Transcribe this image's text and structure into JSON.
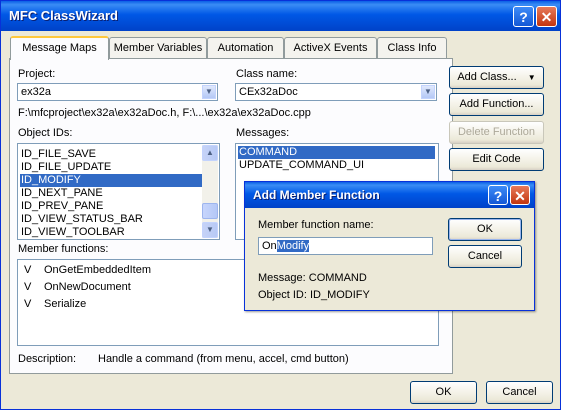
{
  "window": {
    "title": "MFC ClassWizard",
    "help_glyph": "?",
    "close_glyph": "✕"
  },
  "tabs": [
    "Message Maps",
    "Member Variables",
    "Automation",
    "ActiveX Events",
    "Class Info"
  ],
  "project": {
    "label": "Project:",
    "value": "ex32a"
  },
  "class_name": {
    "label": "Class name:",
    "value": "CEx32aDoc"
  },
  "path": "F:\\mfcproject\\ex32a\\ex32aDoc.h, F:\\...\\ex32a\\ex32aDoc.cpp",
  "object_ids": {
    "label": "Object IDs:",
    "items": [
      "ID_FILE_SAVE",
      "ID_FILE_UPDATE",
      "ID_MODIFY",
      "ID_NEXT_PANE",
      "ID_PREV_PANE",
      "ID_VIEW_STATUS_BAR",
      "ID_VIEW_TOOLBAR"
    ],
    "selected": "ID_MODIFY"
  },
  "messages": {
    "label": "Messages:",
    "items": [
      "COMMAND",
      "UPDATE_COMMAND_UI"
    ],
    "selected": "COMMAND"
  },
  "member_functions": {
    "label": "Member functions:",
    "items": [
      {
        "flag": "V",
        "name": "OnGetEmbeddedItem"
      },
      {
        "flag": "V",
        "name": "OnNewDocument"
      },
      {
        "flag": "V",
        "name": "Serialize"
      }
    ]
  },
  "description": {
    "label": "Description:",
    "text": "Handle a command (from menu, accel, cmd button)"
  },
  "side_buttons": {
    "add_class": "Add Class...",
    "add_function": "Add Function...",
    "delete_function": "Delete Function",
    "edit_code": "Edit Code"
  },
  "footer_buttons": {
    "ok": "OK",
    "cancel": "Cancel"
  },
  "dialog": {
    "title": "Add Member Function",
    "field_label": "Member function name:",
    "field_prefix": "On",
    "field_selected": "Modify",
    "message_line": "Message: COMMAND",
    "object_line": "Object ID: ID_MODIFY",
    "ok": "OK",
    "cancel": "Cancel"
  }
}
